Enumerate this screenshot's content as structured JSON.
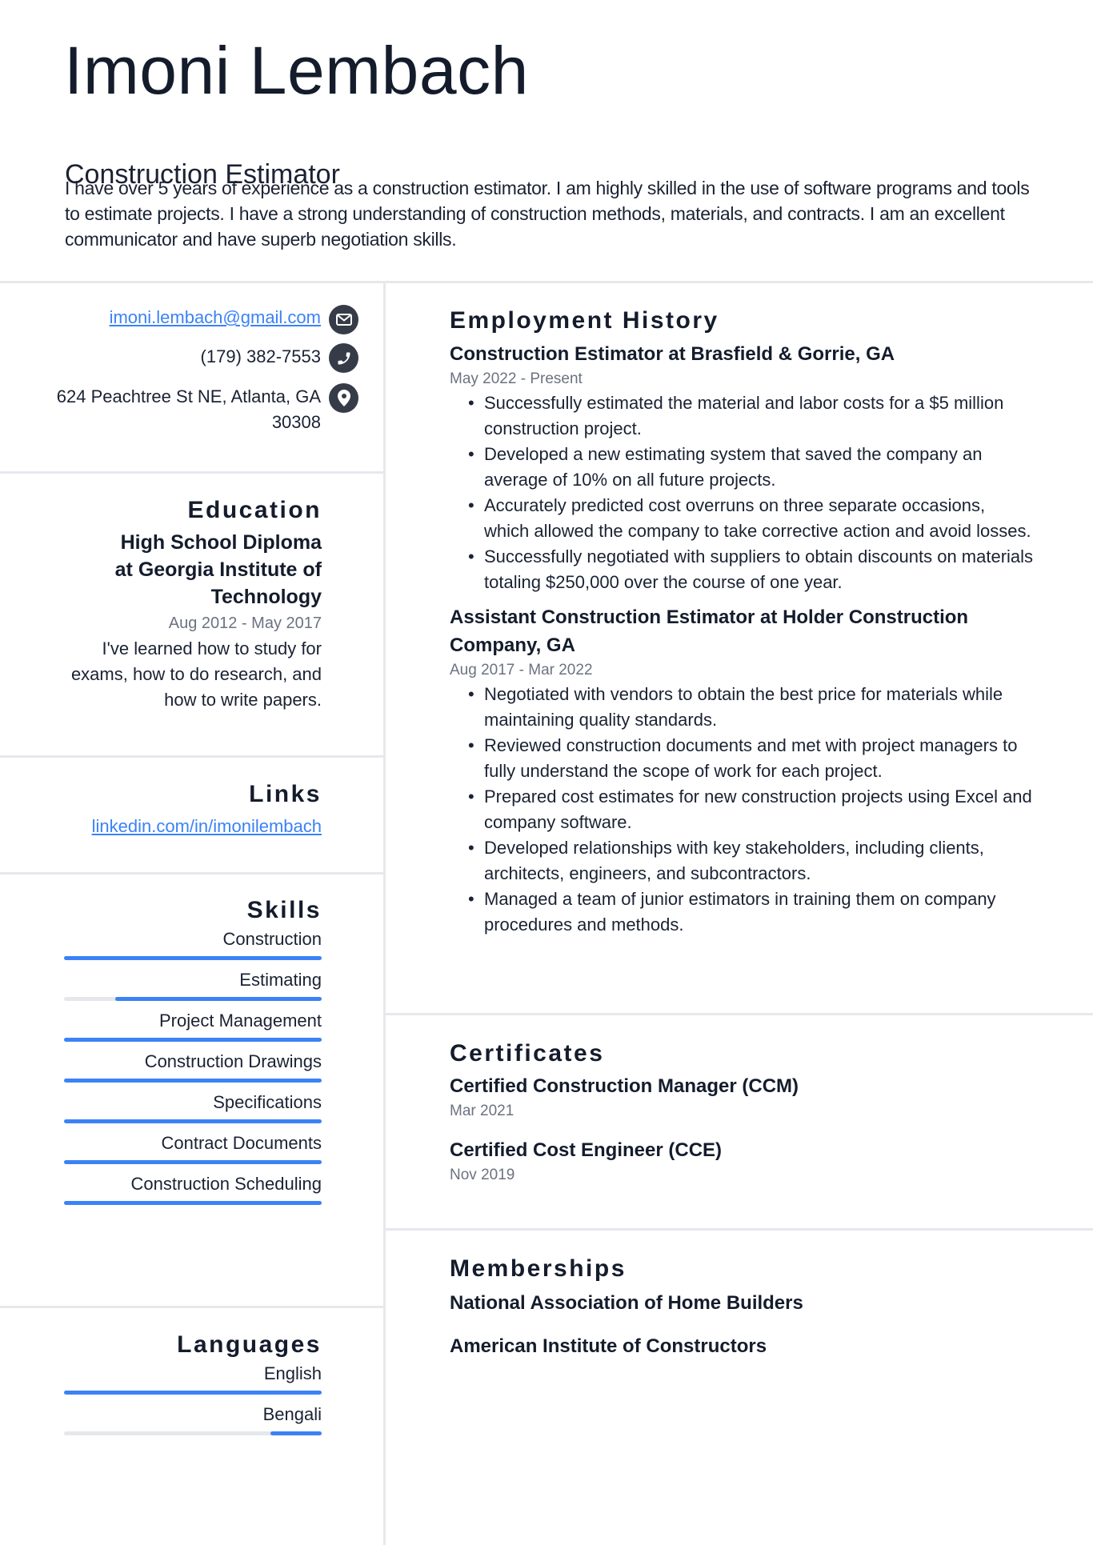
{
  "header": {
    "name": "Imoni Lembach",
    "title": "Construction Estimator",
    "summary": "I have over 5 years of experience as a construction estimator. I am highly skilled in the use of software programs and tools to estimate projects. I have a strong understanding of construction methods, materials, and contracts. I am an excellent communicator and have superb negotiation skills."
  },
  "colors": {
    "accent": "#3b82f6",
    "text": "#141c2c",
    "muted": "#6b7280",
    "icon_bg": "#363c47",
    "divider": "#e6e8ec",
    "track": "#e5e7eb"
  },
  "contact": {
    "email": "imoni.lembach@gmail.com",
    "email_icon": "envelope-icon",
    "phone": "(179) 382-7553",
    "phone_icon": "phone-icon",
    "address_line1": "624 Peachtree St NE, Atlanta, GA",
    "address_line2": "30308",
    "address_icon": "map-pin-icon"
  },
  "education": {
    "heading": "Education",
    "items": [
      {
        "degree_line1": "High School Diploma",
        "degree_line2": "at Georgia Institute of",
        "degree_line3": "Technology",
        "dates": "Aug 2012 - May 2017",
        "desc_line1": "I've learned how to study for",
        "desc_line2": "exams, how to do research, and",
        "desc_line3": "how to write papers."
      }
    ]
  },
  "links": {
    "heading": "Links",
    "items": [
      {
        "label": "linkedin.com/in/imonilembach"
      }
    ]
  },
  "skills": {
    "heading": "Skills",
    "items": [
      {
        "label": "Construction",
        "level": 1.0
      },
      {
        "label": "Estimating",
        "level": 0.8
      },
      {
        "label": "Project Management",
        "level": 1.0
      },
      {
        "label": "Construction Drawings",
        "level": 1.0
      },
      {
        "label": "Specifications",
        "level": 1.0
      },
      {
        "label": "Contract Documents",
        "level": 1.0
      },
      {
        "label": "Construction Scheduling",
        "level": 1.0
      }
    ]
  },
  "languages": {
    "heading": "Languages",
    "items": [
      {
        "label": "English",
        "level": 1.0
      },
      {
        "label": "Bengali",
        "level": 0.2
      }
    ]
  },
  "employment": {
    "heading": "Employment History",
    "jobs": [
      {
        "title": "Construction Estimator at Brasfield & Gorrie, GA",
        "dates": "May 2022 - Present",
        "bullets": [
          "Successfully estimated the material and labor costs for a $5 million construction project.",
          "Developed a new estimating system that saved the company an average of 10% on all future projects.",
          "Accurately predicted cost overruns on three separate occasions, which allowed the company to take corrective action and avoid losses.",
          "Successfully negotiated with suppliers to obtain discounts on materials totaling $250,000 over the course of one year."
        ]
      },
      {
        "title": "Assistant Construction Estimator at Holder Construction Company, GA",
        "dates": "Aug 2017 - Mar 2022",
        "bullets": [
          "Negotiated with vendors to obtain the best price for materials while maintaining quality standards.",
          "Reviewed construction documents and met with project managers to fully understand the scope of work for each project.",
          "Prepared cost estimates for new construction projects using Excel and company software.",
          "Developed relationships with key stakeholders, including clients, architects, engineers, and subcontractors.",
          "Managed a team of junior estimators in training them on company procedures and methods."
        ]
      }
    ]
  },
  "certificates": {
    "heading": "Certificates",
    "items": [
      {
        "name": "Certified Construction Manager (CCM)",
        "date": "Mar 2021"
      },
      {
        "name": "Certified Cost Engineer (CCE)",
        "date": "Nov 2019"
      }
    ]
  },
  "memberships": {
    "heading": "Memberships",
    "items": [
      {
        "name": "National Association of Home Builders"
      },
      {
        "name": "American Institute of Constructors"
      }
    ]
  }
}
